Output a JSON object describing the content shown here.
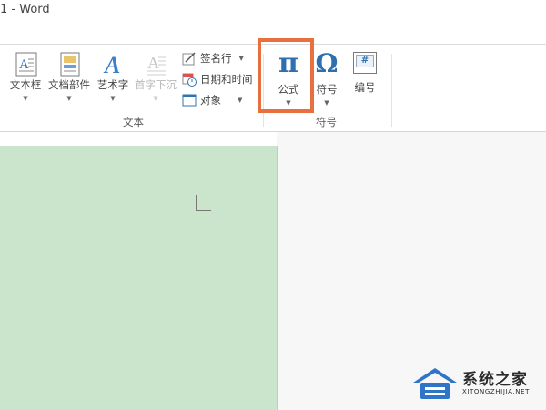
{
  "window": {
    "title": "1 - Word"
  },
  "ribbon": {
    "text_group": {
      "label": "文本",
      "buttons": [
        {
          "label": "文本框",
          "icon": "text-box-icon"
        },
        {
          "label": "文档部件",
          "icon": "quick-parts-icon"
        },
        {
          "label": "艺术字",
          "icon": "wordart-icon"
        },
        {
          "label": "首字下沉",
          "icon": "drop-cap-icon",
          "disabled": true
        }
      ],
      "small_buttons": [
        {
          "label": "签名行",
          "icon": "signature-line-icon"
        },
        {
          "label": "日期和时间",
          "icon": "date-time-icon"
        },
        {
          "label": "对象",
          "icon": "object-icon"
        }
      ]
    },
    "symbols_group": {
      "label": "符号",
      "buttons": [
        {
          "label": "公式",
          "glyph": "π",
          "icon": "equation-pi-icon"
        },
        {
          "label": "符号",
          "glyph": "Ω",
          "icon": "symbol-omega-icon"
        },
        {
          "label": "编号",
          "glyph": "#",
          "icon": "number-icon"
        }
      ]
    },
    "accent_color": "#e8703f"
  },
  "watermark": {
    "name": "系统之家",
    "url": "XITONGZHIJIA.NET"
  }
}
